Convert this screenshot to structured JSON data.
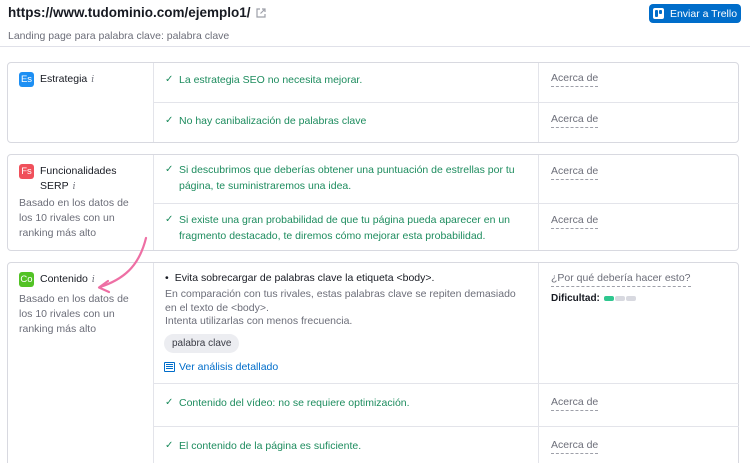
{
  "header": {
    "url": "https://www.tudominio.com/ejemplo1/",
    "subtitle": "Landing page para palabra clave: palabra clave",
    "trello_button": "Enviar a Trello"
  },
  "colors": {
    "accent": "#006dca",
    "check_green": "#1d8c5e",
    "strategy_badge": "#1d8ff3",
    "serp_badge": "#f0505b",
    "content_badge": "#52c225",
    "annotation_arrow": "#ee6fa4",
    "difficulty_fill": "#2fc78f"
  },
  "categories": {
    "strategy": {
      "badge": "Es",
      "title": "Estrategia",
      "rows": [
        {
          "text": "La estrategia SEO no necesita mejorar.",
          "action": "Acerca de"
        },
        {
          "text": "No hay canibalización de palabras clave",
          "action": "Acerca de"
        }
      ]
    },
    "serp": {
      "badge": "Fs",
      "title_line1": "Funcionalidades",
      "title_line2": "SERP",
      "note": "Basado en los datos de los 10 rivales con un ranking más alto",
      "rows": [
        {
          "text": "Si descubrimos que deberías obtener una puntuación de estrellas por tu página, te suministraremos una idea.",
          "action": "Acerca de"
        },
        {
          "text": "Si existe una gran probabilidad de que tu página pueda aparecer en un fragmento destacado, te diremos cómo mejorar esta probabilidad.",
          "action": "Acerca de"
        }
      ]
    },
    "content": {
      "badge": "Co",
      "title": "Contenido",
      "note": "Basado en los datos de los 10 rivales con un ranking más alto",
      "detail": {
        "title": "Evita sobrecargar de palabras clave la etiqueta <body>.",
        "description": "En comparación con tus rivales, estas palabras clave se repiten demasiado en el texto de <body>.",
        "advice": "Intenta utilizarlas con menos frecuencia.",
        "tag": "palabra clave",
        "link": "Ver análisis detallado",
        "why": "¿Por qué debería hacer esto?",
        "difficulty_label": "Dificultad:",
        "difficulty_level": 1,
        "difficulty_max": 3
      },
      "rows": [
        {
          "text": "Contenido del vídeo: no se requiere optimización.",
          "action": "Acerca de"
        },
        {
          "text": "El contenido de la página es suficiente.",
          "action": "Acerca de"
        }
      ]
    }
  }
}
